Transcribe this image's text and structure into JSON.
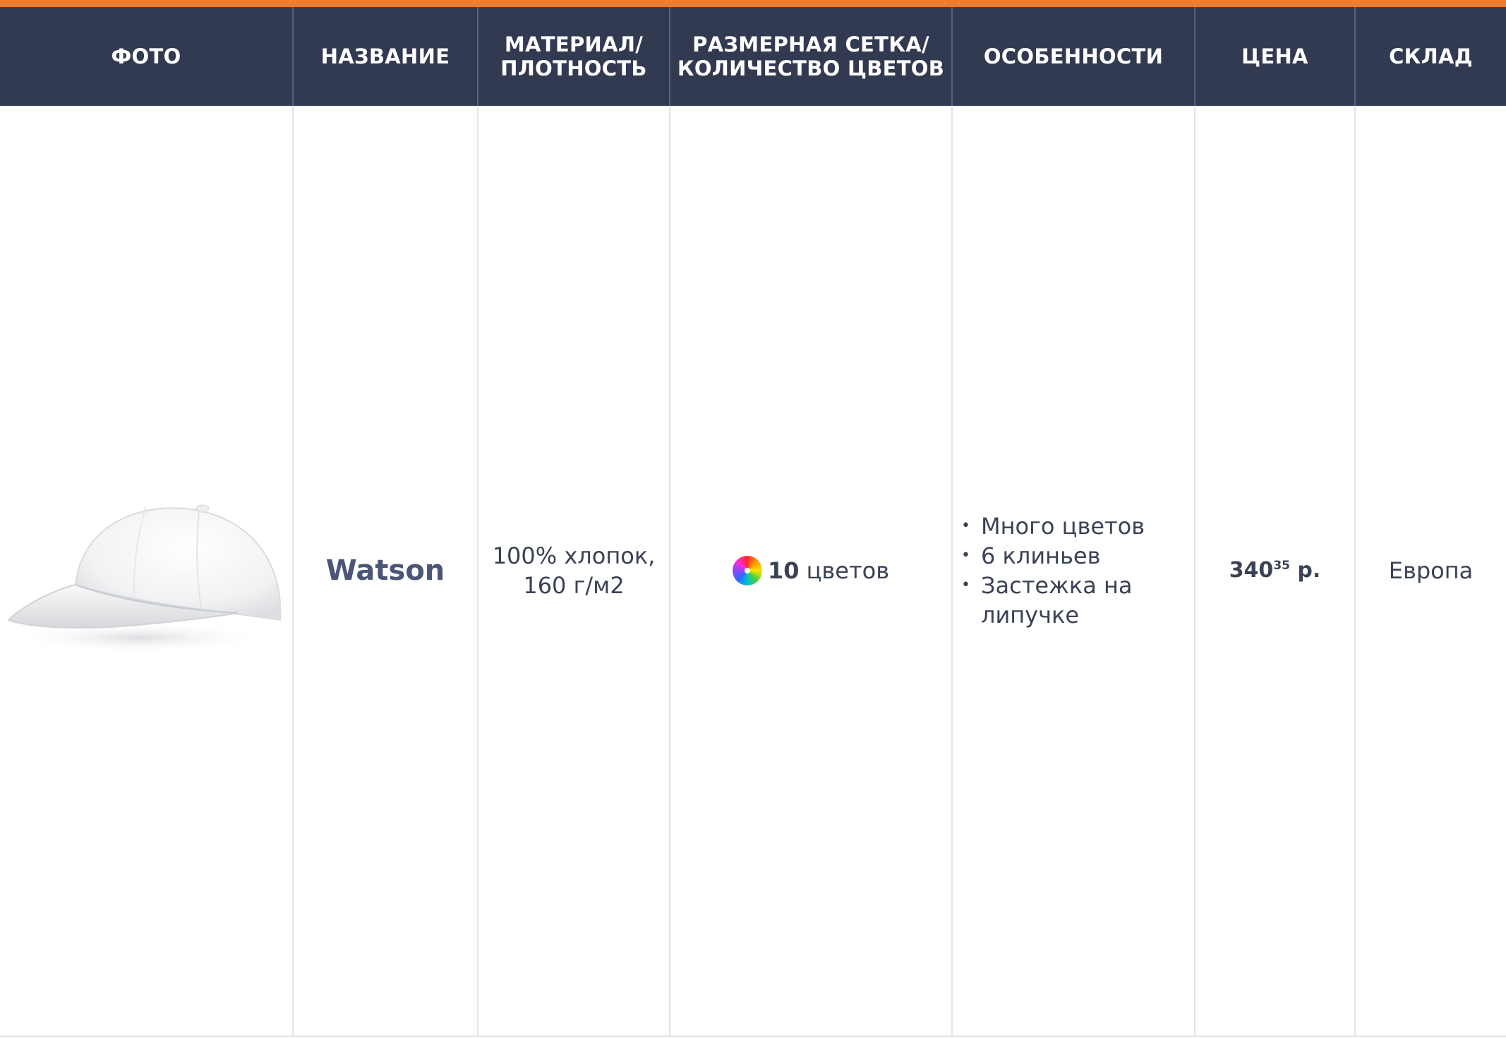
{
  "colors": {
    "accent": "#ee7d31",
    "header_bg": "#313a51",
    "header_text": "#ffffff",
    "name_text": "#4a5577"
  },
  "headers": {
    "photo": "ФОТО",
    "name": "НАЗВАНИЕ",
    "material": "МАТЕРИАЛ/\nПЛОТНОСТЬ",
    "size": "РАЗМЕРНАЯ СЕТКА/\nКОЛИЧЕСТВО ЦВЕТОВ",
    "features": "ОСОБЕННОСТИ",
    "price": "ЦЕНА",
    "stock": "СКЛАД"
  },
  "product": {
    "photo_alt": "white-cap-photo",
    "name": "Watson",
    "material": "100% хлопок,\n160 г/м2",
    "colors_count": "10",
    "colors_label": " цветов",
    "colors_icon": "color-wheel-icon",
    "features": [
      "Много цветов",
      "6 клиньев",
      "Застежка на липучке"
    ],
    "price_main": "340",
    "price_kopecks": "35",
    "price_currency": " р.",
    "stock": "Европа"
  }
}
